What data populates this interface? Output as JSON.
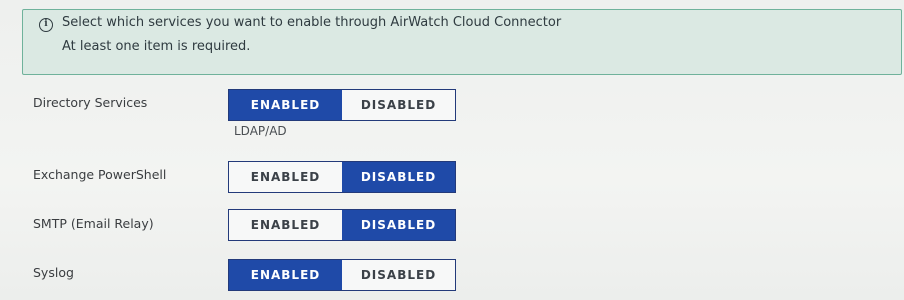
{
  "banner": {
    "icon": "info-icon",
    "icon_glyph": "i",
    "message": "Select which services you want to enable through AirWatch Cloud Connector",
    "requirement": "At least one item is required."
  },
  "services": [
    {
      "label": "Directory Services",
      "enabled_label": "ENABLED",
      "disabled_label": "DISABLED",
      "state": "enabled",
      "sublabel": "LDAP/AD"
    },
    {
      "label": "Exchange PowerShell",
      "enabled_label": "ENABLED",
      "disabled_label": "DISABLED",
      "state": "disabled"
    },
    {
      "label": "SMTP (Email Relay)",
      "enabled_label": "ENABLED",
      "disabled_label": "DISABLED",
      "state": "disabled"
    },
    {
      "label": "Syslog",
      "enabled_label": "ENABLED",
      "disabled_label": "DISABLED",
      "state": "enabled"
    }
  ],
  "colors": {
    "active": "#1f4aa8",
    "banner_bg": "#dbe9e3",
    "banner_border": "#6fb29b"
  }
}
